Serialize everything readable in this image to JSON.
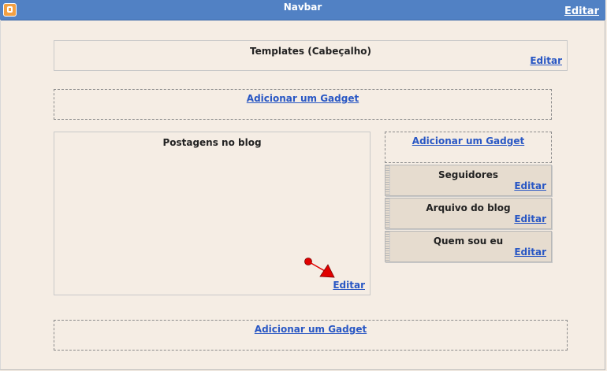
{
  "navbar": {
    "title": "Navbar",
    "edit_label": "Editar"
  },
  "header": {
    "title": "Templates (Cabeçalho)",
    "edit_label": "Editar"
  },
  "add_gadget_label": "Adicionar um Gadget",
  "main": {
    "title": "Postagens no blog",
    "edit_label": "Editar"
  },
  "sidebar": {
    "add_gadget_label": "Adicionar um Gadget",
    "widgets": [
      {
        "title": "Seguidores",
        "edit_label": "Editar"
      },
      {
        "title": "Arquivo do blog",
        "edit_label": "Editar"
      },
      {
        "title": "Quem sou eu",
        "edit_label": "Editar"
      }
    ]
  },
  "footer": {
    "add_gadget_label": "Adicionar um Gadget"
  },
  "colors": {
    "navbar": "#5181c4",
    "background": "#f5ede4",
    "link": "#2957c4",
    "widget": "#e6dccf",
    "pointer": "#e00000"
  }
}
